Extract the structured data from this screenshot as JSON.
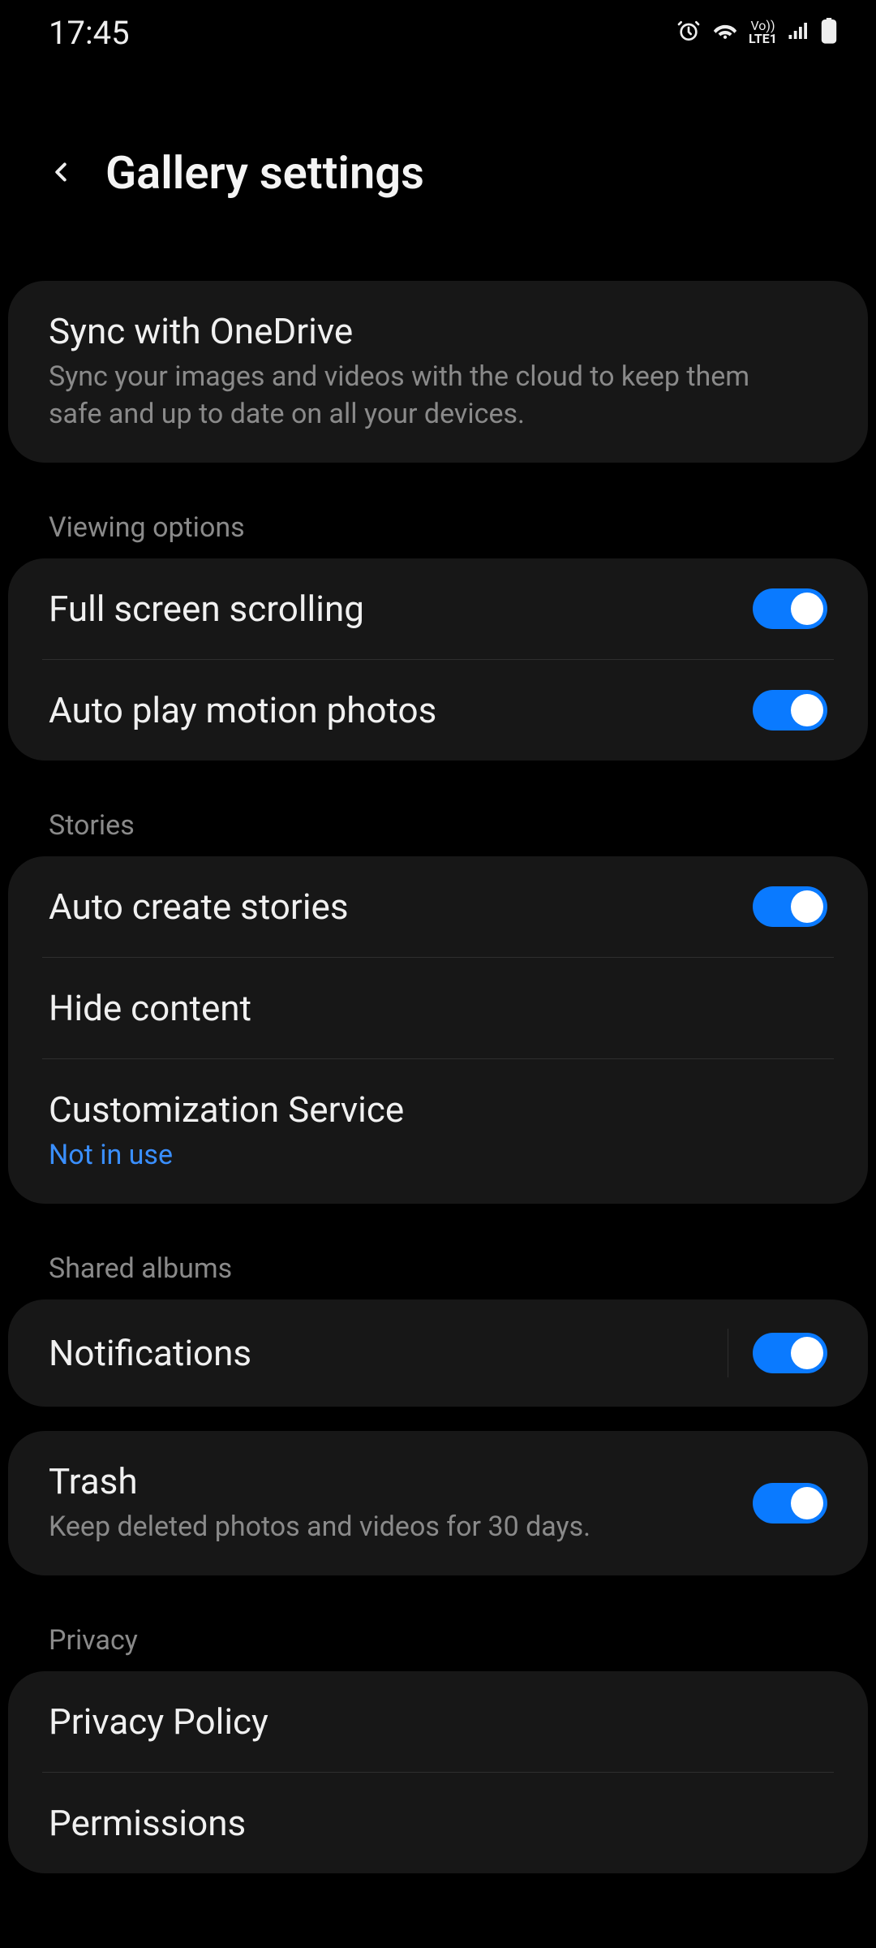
{
  "status": {
    "time": "17:45",
    "lte_label": "LTE1",
    "vo_label": "Vo))"
  },
  "header": {
    "title": "Gallery settings"
  },
  "sync": {
    "title": "Sync with OneDrive",
    "sub": "Sync your images and videos with the cloud to keep them safe and up to date on all your devices."
  },
  "sections": {
    "viewing": {
      "label": "Viewing options",
      "full_screen": {
        "title": "Full screen scrolling",
        "on": true
      },
      "motion": {
        "title": "Auto play motion photos",
        "on": true
      }
    },
    "stories": {
      "label": "Stories",
      "auto": {
        "title": "Auto create stories",
        "on": true
      },
      "hide": {
        "title": "Hide content"
      },
      "custom": {
        "title": "Customization Service",
        "sub": "Not in use"
      }
    },
    "shared": {
      "label": "Shared albums",
      "notif": {
        "title": "Notifications",
        "on": true
      }
    },
    "trash": {
      "title": "Trash",
      "sub": "Keep deleted photos and videos for 30 days.",
      "on": true
    },
    "privacy": {
      "label": "Privacy",
      "policy": {
        "title": "Privacy Policy"
      },
      "perm": {
        "title": "Permissions"
      }
    }
  }
}
